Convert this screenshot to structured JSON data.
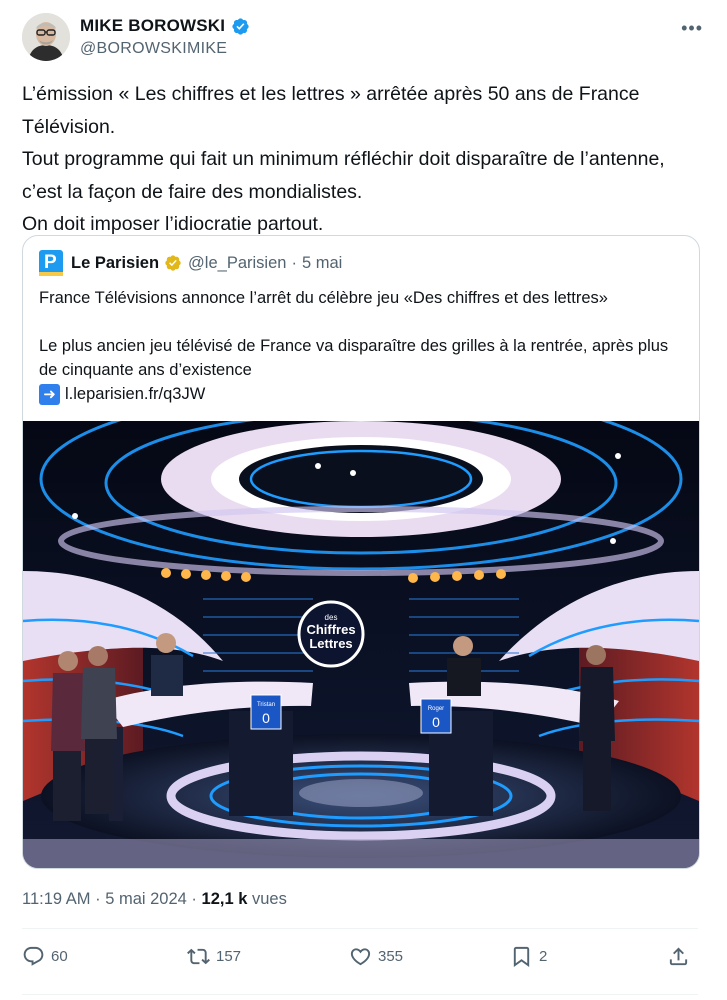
{
  "author": {
    "name": "MIKE BOROWSKI",
    "handle": "@BOROWSKIMIKE"
  },
  "tweet_lines": [
    "L’émission « Les chiffres et les lettres » arrêtée après 50 ans de France Télévision.",
    "Tout programme qui fait un minimum réfléchir doit disparaître de l’antenne, c’est la façon de faire des mondialistes.",
    "On doit imposer l’idiocratie partout."
  ],
  "quote": {
    "name": "Le Parisien",
    "handle": "@le_Parisien",
    "separator": "·",
    "date": "5 mai",
    "text_line1": "France Télévisions annonce l’arrêt du célèbre jeu «Des chiffres et des lettres»",
    "text_line2": "Le plus ancien jeu télévisé de France va disparaître des grilles à la rentrée, après plus de cinquante ans d’existence",
    "link": "l.leparisien.fr/q3JW",
    "image_logo_text": [
      "des",
      "Chiffres",
      "Lettres"
    ],
    "score_labels": [
      "Tristan",
      "Roger"
    ],
    "scores": [
      "0",
      "0"
    ]
  },
  "meta": {
    "time": "11:19 AM",
    "separator": "·",
    "date": "5 mai 2024",
    "views_count": "12,1 k",
    "views_label": "vues"
  },
  "actions": {
    "replies": "60",
    "retweets": "157",
    "likes": "355",
    "bookmarks": "2"
  },
  "icons": [
    "verified-badge-icon",
    "gold-verified-badge-icon",
    "more-options-icon",
    "arrow-right-icon",
    "reply-icon",
    "retweet-icon",
    "like-icon",
    "bookmark-icon",
    "share-icon"
  ],
  "colors": {
    "verified_blue": "#1d9bf0",
    "gold_badge": "#e2b719",
    "secondary_text": "#536471"
  }
}
